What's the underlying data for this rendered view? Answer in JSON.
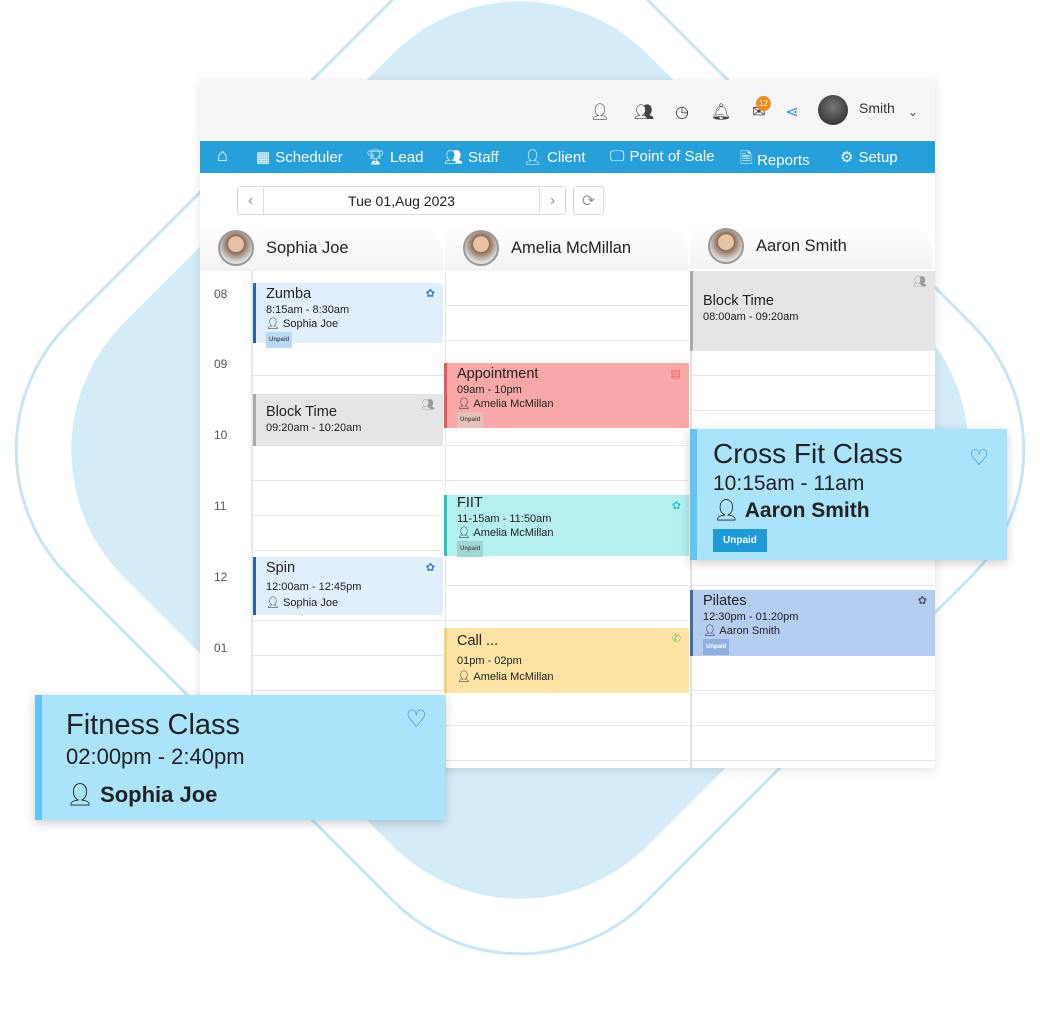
{
  "header": {
    "user_name": "Smith",
    "mail_count": "12",
    "icons": [
      "user-check-icon",
      "user-clock-icon",
      "clock-icon",
      "bell-icon",
      "mail-icon",
      "share-icon",
      "chevron-down-icon"
    ]
  },
  "nav": {
    "items": [
      {
        "label": "Scheduler",
        "icon": "calendar-icon"
      },
      {
        "label": "Lead",
        "icon": "trophy-icon"
      },
      {
        "label": "Staff",
        "icon": "users-icon"
      },
      {
        "label": "Client",
        "icon": "user-icon"
      },
      {
        "label": "Point of Sale",
        "icon": "monitor-icon"
      },
      {
        "label": "Reports",
        "icon": "report-icon"
      },
      {
        "label": "Setup",
        "icon": "gears-icon"
      }
    ]
  },
  "date": {
    "value": "Tue 01,Aug 2023",
    "prev": "‹",
    "next": "›"
  },
  "staff": [
    "Sophia Joe",
    "Amelia McMillan",
    "Aaron Smith"
  ],
  "times": [
    "08",
    "09",
    "10",
    "11",
    "12",
    "01"
  ],
  "events": {
    "zumba": {
      "title": "Zumba",
      "time": "8:15am - 8:30am",
      "person": "Sophia Joe",
      "status": "Unpaid"
    },
    "block1": {
      "title": "Block Time",
      "time": "09:20am - 10:20am"
    },
    "spin": {
      "title": "Spin",
      "time": "12:00am - 12:45pm",
      "person": "Sophia Joe"
    },
    "appointment": {
      "title": "Appointment",
      "time": "09am - 10pm",
      "person": "Amelia McMillan",
      "status": "Unpaid"
    },
    "fiit": {
      "title": "FIIT",
      "time": "11-15am - 11:50am",
      "person": "Amelia McMillan",
      "status": "Unpaid"
    },
    "call": {
      "title": "Call ...",
      "time": "01pm - 02pm",
      "person": "Amelia McMillan"
    },
    "block3": {
      "title": "Block Time",
      "time": "08:00am - 09:20am"
    },
    "pilates": {
      "title": "Pilates",
      "time": "12:30pm - 01:20pm",
      "person": "Aaron Smith",
      "status": "Unpaid"
    }
  },
  "popups": {
    "crossfit": {
      "title": "Cross Fit Class",
      "time": "10:15am - 11am",
      "person": "Aaron Smith",
      "status": "Unpaid"
    },
    "fitness": {
      "title": "Fitness Class",
      "time": "02:00pm - 2:40pm",
      "person": "Sophia Joe"
    }
  },
  "colors": {
    "nav": "#26a0da",
    "class": "#e1effc",
    "block": "#e5e5e5",
    "appointment": "#f8a8a8",
    "fiit": "#b3f0ef",
    "call": "#fde3a4",
    "pilates": "#b4cdf0",
    "popup": "#a9e4fb"
  }
}
